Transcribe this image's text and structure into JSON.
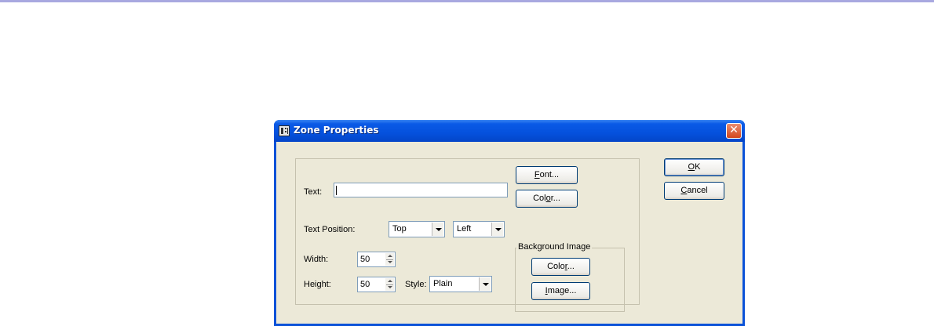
{
  "dialog": {
    "title": "Zone Properties",
    "close_glyph": "✕"
  },
  "labels": {
    "text": "Text:",
    "text_position": "Text Position:",
    "width": "Width:",
    "height": "Height:",
    "style": "Style:"
  },
  "fields": {
    "text_value": "",
    "width_value": "50",
    "height_value": "50"
  },
  "combos": {
    "vertical_position": "Top",
    "horizontal_position": "Left",
    "style": "Plain"
  },
  "buttons": {
    "font_mnemonic": "F",
    "font_rest": "ont...",
    "color_pre": "Col",
    "color_mnemonic": "o",
    "color_rest": "r...",
    "bg_color_pre": "Colo",
    "bg_color_mnemonic": "r",
    "bg_color_rest": "...",
    "image_mnemonic": "I",
    "image_rest": "mage...",
    "ok_mnemonic": "O",
    "ok_rest": "K",
    "cancel_mnemonic": "C",
    "cancel_rest": "ancel"
  },
  "background_group": {
    "legend": "Background Image"
  },
  "icons": {
    "title_icon": "zone-properties-icon",
    "close_icon": "close-icon"
  }
}
